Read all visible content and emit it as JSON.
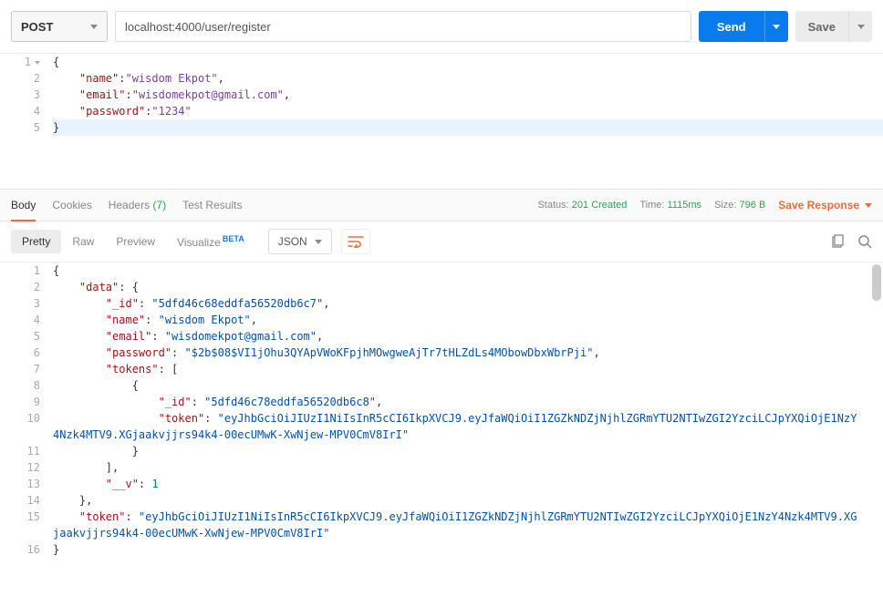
{
  "toolbar": {
    "method": "POST",
    "url": "localhost:4000/user/register",
    "send_label": "Send",
    "save_label": "Save"
  },
  "request_body": {
    "lines": [
      "1",
      "2",
      "3",
      "4",
      "5"
    ],
    "tokens": [
      [
        {
          "t": "punc",
          "v": "{"
        }
      ],
      [
        {
          "t": "pad",
          "v": "    "
        },
        {
          "t": "key",
          "v": "\"name\""
        },
        {
          "t": "punc",
          "v": ":"
        },
        {
          "t": "str",
          "v": "\"wisdom Ekpot\""
        },
        {
          "t": "punc",
          "v": ","
        }
      ],
      [
        {
          "t": "pad",
          "v": "    "
        },
        {
          "t": "key",
          "v": "\"email\""
        },
        {
          "t": "punc",
          "v": ":"
        },
        {
          "t": "str",
          "v": "\"wisdomekpot@gmail.com\""
        },
        {
          "t": "punc",
          "v": ","
        }
      ],
      [
        {
          "t": "pad",
          "v": "    "
        },
        {
          "t": "key",
          "v": "\"password\""
        },
        {
          "t": "punc",
          "v": ":"
        },
        {
          "t": "str",
          "v": "\"1234\""
        }
      ],
      [
        {
          "t": "punc",
          "v": "}"
        }
      ]
    ]
  },
  "response_tabs": {
    "body": "Body",
    "cookies": "Cookies",
    "headers": "Headers",
    "headers_count": "(7)",
    "test_results": "Test Results"
  },
  "response_meta": {
    "status_label": "Status:",
    "status_value": "201 Created",
    "time_label": "Time:",
    "time_value": "1115ms",
    "size_label": "Size:",
    "size_value": "796 B",
    "save_response": "Save Response"
  },
  "view_tabs": {
    "pretty": "Pretty",
    "raw": "Raw",
    "preview": "Preview",
    "visualize": "Visualize",
    "beta": "BETA",
    "format": "JSON"
  },
  "response_body": {
    "lines": [
      "1",
      "2",
      "3",
      "4",
      "5",
      "6",
      "7",
      "8",
      "9",
      "10",
      "",
      "11",
      "12",
      "13",
      "14",
      "15",
      "",
      "16"
    ],
    "tokens": [
      [
        {
          "t": "punc",
          "v": "{"
        }
      ],
      [
        {
          "t": "pad",
          "v": "    "
        },
        {
          "t": "key",
          "v": "\"data\""
        },
        {
          "t": "punc",
          "v": ": {"
        }
      ],
      [
        {
          "t": "pad",
          "v": "        "
        },
        {
          "t": "key",
          "v": "\"_id\""
        },
        {
          "t": "punc",
          "v": ": "
        },
        {
          "t": "str",
          "v": "\"5dfd46c68eddfa56520db6c7\""
        },
        {
          "t": "punc",
          "v": ","
        }
      ],
      [
        {
          "t": "pad",
          "v": "        "
        },
        {
          "t": "key",
          "v": "\"name\""
        },
        {
          "t": "punc",
          "v": ": "
        },
        {
          "t": "str",
          "v": "\"wisdom Ekpot\""
        },
        {
          "t": "punc",
          "v": ","
        }
      ],
      [
        {
          "t": "pad",
          "v": "        "
        },
        {
          "t": "key",
          "v": "\"email\""
        },
        {
          "t": "punc",
          "v": ": "
        },
        {
          "t": "str",
          "v": "\"wisdomekpot@gmail.com\""
        },
        {
          "t": "punc",
          "v": ","
        }
      ],
      [
        {
          "t": "pad",
          "v": "        "
        },
        {
          "t": "key",
          "v": "\"password\""
        },
        {
          "t": "punc",
          "v": ": "
        },
        {
          "t": "str",
          "v": "\"$2b$08$VI1jOhu3QYApVWoKFpjhMOwgweAjTr7tHLZdLs4MObowDbxWbrPji\""
        },
        {
          "t": "punc",
          "v": ","
        }
      ],
      [
        {
          "t": "pad",
          "v": "        "
        },
        {
          "t": "key",
          "v": "\"tokens\""
        },
        {
          "t": "punc",
          "v": ": ["
        }
      ],
      [
        {
          "t": "pad",
          "v": "            "
        },
        {
          "t": "punc",
          "v": "{"
        }
      ],
      [
        {
          "t": "pad",
          "v": "                "
        },
        {
          "t": "key",
          "v": "\"_id\""
        },
        {
          "t": "punc",
          "v": ": "
        },
        {
          "t": "str",
          "v": "\"5dfd46c78eddfa56520db6c8\""
        },
        {
          "t": "punc",
          "v": ","
        }
      ],
      [
        {
          "t": "pad",
          "v": "                "
        },
        {
          "t": "key",
          "v": "\"token\""
        },
        {
          "t": "punc",
          "v": ": "
        },
        {
          "t": "str",
          "v": "\"eyJhbGciOiJIUzI1NiIsInR5cCI6IkpXVCJ9.eyJfaWQiOiI1ZGZkNDZjNjhlZGRmYTU2NTIwZGI2YzciLCJpYXQiOjE1NzY4Nzk4MTV9.XGjaakvjjrs94k4-00ecUMwK-XwNjew-MPV0CmV8IrI\""
        }
      ],
      [
        {
          "t": "pad",
          "v": "            "
        },
        {
          "t": "punc",
          "v": "}"
        }
      ],
      [
        {
          "t": "pad",
          "v": "        "
        },
        {
          "t": "punc",
          "v": "],"
        }
      ],
      [
        {
          "t": "pad",
          "v": "        "
        },
        {
          "t": "key",
          "v": "\"__v\""
        },
        {
          "t": "punc",
          "v": ": "
        },
        {
          "t": "num",
          "v": "1"
        }
      ],
      [
        {
          "t": "pad",
          "v": "    "
        },
        {
          "t": "punc",
          "v": "},"
        }
      ],
      [
        {
          "t": "pad",
          "v": "    "
        },
        {
          "t": "key",
          "v": "\"token\""
        },
        {
          "t": "punc",
          "v": ": "
        },
        {
          "t": "str",
          "v": "\"eyJhbGciOiJIUzI1NiIsInR5cCI6IkpXVCJ9.eyJfaWQiOiI1ZGZkNDZjNjhlZGRmYTU2NTIwZGI2YzciLCJpYXQiOjE1NzY4Nzk4MTV9.XGjaakvjjrs94k4-00ecUMwK-XwNjew-MPV0CmV8IrI\""
        }
      ],
      [
        {
          "t": "punc",
          "v": "}"
        }
      ]
    ],
    "wrap_rows": {
      "9": 2,
      "14": 2
    }
  }
}
